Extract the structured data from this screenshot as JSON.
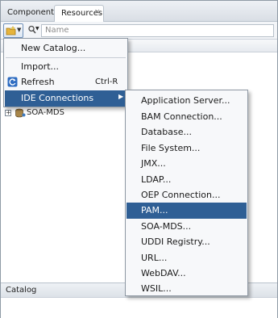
{
  "tabs": [
    {
      "label": "Components"
    },
    {
      "label": "Resources",
      "close": "×"
    }
  ],
  "search": {
    "placeholder": "Name"
  },
  "tree": {
    "items": [
      {
        "label": "SOA-MDS",
        "expander": "+"
      }
    ]
  },
  "context_menu": {
    "items": [
      {
        "label": "New Catalog..."
      },
      {
        "label": "Import..."
      },
      {
        "label": "Refresh",
        "shortcut": "Ctrl-R"
      },
      {
        "label": "IDE Connections",
        "submenu_marker": "▶"
      }
    ]
  },
  "submenu": {
    "items": [
      {
        "label": "Application Server..."
      },
      {
        "label": "BAM Connection..."
      },
      {
        "label": "Database..."
      },
      {
        "label": "File System..."
      },
      {
        "label": "JMX..."
      },
      {
        "label": "LDAP..."
      },
      {
        "label": "OEP Connection..."
      },
      {
        "label": "PAM..."
      },
      {
        "label": "SOA-MDS..."
      },
      {
        "label": "UDDI Registry..."
      },
      {
        "label": "URL..."
      },
      {
        "label": "WebDAV..."
      },
      {
        "label": "WSIL..."
      }
    ]
  },
  "footer": {
    "title": "Catalog"
  },
  "colors": {
    "highlight": "#2f5f95",
    "menu_bg": "#f7f8fa"
  }
}
